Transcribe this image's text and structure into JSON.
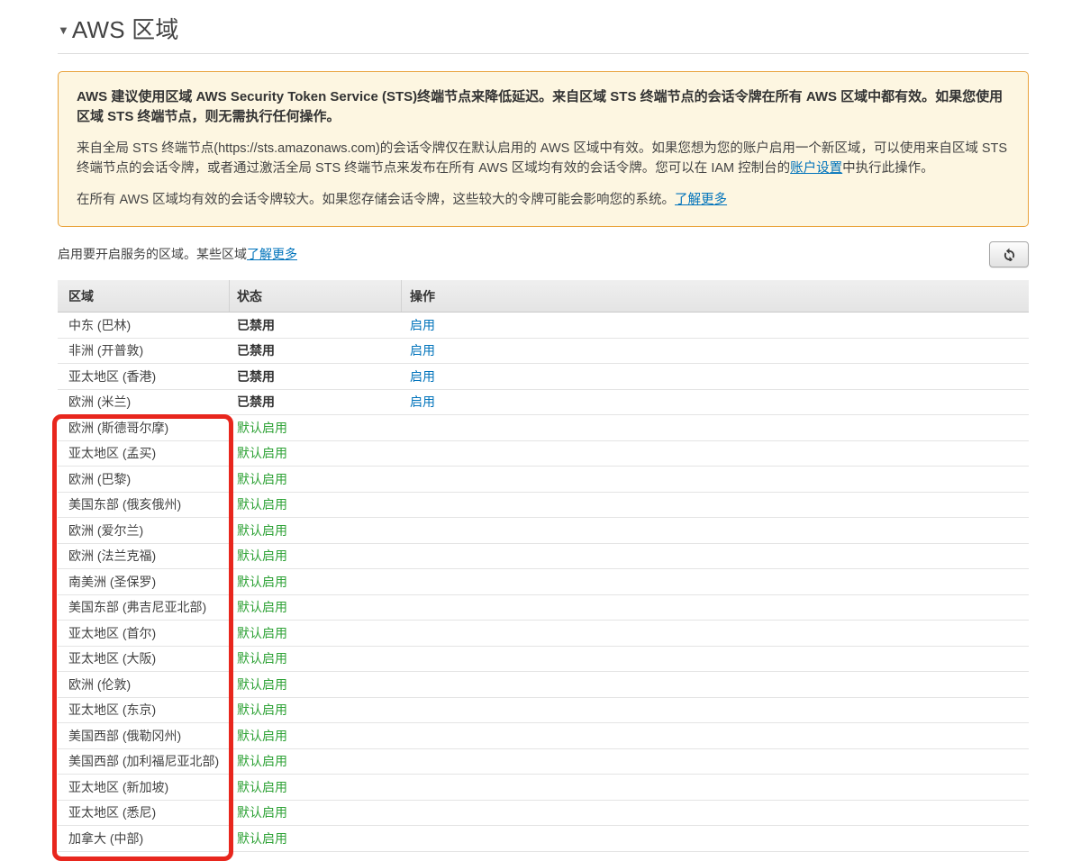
{
  "page": {
    "title": "AWS 区域",
    "collapse_icon": "▼"
  },
  "notice": {
    "bold_text": "AWS 建议使用区域 AWS Security Token Service (STS)终端节点来降低延迟。来自区域 STS 终端节点的会话令牌在所有 AWS 区域中都有效。如果您使用区域 STS 终端节点，则无需执行任何操作。",
    "para2_before_link": "来自全局 STS 终端节点(https://sts.amazonaws.com)的会话令牌仅在默认启用的 AWS 区域中有效。如果您想为您的账户启用一个新区域，可以使用来自区域 STS 终端节点的会话令牌，或者通过激活全局 STS 终端节点来发布在所有 AWS 区域均有效的会话令牌。您可以在 IAM 控制台的",
    "para2_link": "账户设置",
    "para2_after_link": "中执行此操作。",
    "para3_text": "在所有 AWS 区域均有效的会话令牌较大。如果您存储会话令牌，这些较大的令牌可能会影响您的系统。",
    "para3_link": "了解更多"
  },
  "subheader": {
    "text": "启用要开启服务的区域。某些区域",
    "link": "了解更多"
  },
  "table": {
    "headers": [
      "区域",
      "状态",
      "操作"
    ],
    "rows": [
      {
        "region": "中东 (巴林)",
        "status": "已禁用",
        "action": "启用",
        "enabled": false
      },
      {
        "region": "非洲 (开普敦)",
        "status": "已禁用",
        "action": "启用",
        "enabled": false
      },
      {
        "region": "亚太地区 (香港)",
        "status": "已禁用",
        "action": "启用",
        "enabled": false
      },
      {
        "region": "欧洲 (米兰)",
        "status": "已禁用",
        "action": "启用",
        "enabled": false
      },
      {
        "region": "欧洲 (斯德哥尔摩)",
        "status": "默认启用",
        "action": "",
        "enabled": true
      },
      {
        "region": "亚太地区 (孟买)",
        "status": "默认启用",
        "action": "",
        "enabled": true
      },
      {
        "region": "欧洲 (巴黎)",
        "status": "默认启用",
        "action": "",
        "enabled": true
      },
      {
        "region": "美国东部 (俄亥俄州)",
        "status": "默认启用",
        "action": "",
        "enabled": true
      },
      {
        "region": "欧洲 (爱尔兰)",
        "status": "默认启用",
        "action": "",
        "enabled": true
      },
      {
        "region": "欧洲 (法兰克福)",
        "status": "默认启用",
        "action": "",
        "enabled": true
      },
      {
        "region": "南美洲 (圣保罗)",
        "status": "默认启用",
        "action": "",
        "enabled": true
      },
      {
        "region": "美国东部 (弗吉尼亚北部)",
        "status": "默认启用",
        "action": "",
        "enabled": true
      },
      {
        "region": "亚太地区 (首尔)",
        "status": "默认启用",
        "action": "",
        "enabled": true
      },
      {
        "region": "亚太地区 (大阪)",
        "status": "默认启用",
        "action": "",
        "enabled": true
      },
      {
        "region": "欧洲 (伦敦)",
        "status": "默认启用",
        "action": "",
        "enabled": true
      },
      {
        "region": "亚太地区 (东京)",
        "status": "默认启用",
        "action": "",
        "enabled": true
      },
      {
        "region": "美国西部 (俄勒冈州)",
        "status": "默认启用",
        "action": "",
        "enabled": true
      },
      {
        "region": "美国西部 (加利福尼亚北部)",
        "status": "默认启用",
        "action": "",
        "enabled": true
      },
      {
        "region": "亚太地区 (新加坡)",
        "status": "默认启用",
        "action": "",
        "enabled": true
      },
      {
        "region": "亚太地区 (悉尼)",
        "status": "默认启用",
        "action": "",
        "enabled": true
      },
      {
        "region": "加拿大 (中部)",
        "status": "默认启用",
        "action": "",
        "enabled": true
      }
    ]
  },
  "icons": {
    "refresh": "refresh-icon"
  },
  "colors": {
    "link_blue": "#0073bb",
    "status_green": "#2ea236",
    "status_dark": "#333333",
    "notice_border": "#e9a33c",
    "notice_bg": "#fdf6e1",
    "annotation_red": "#e8261d"
  }
}
